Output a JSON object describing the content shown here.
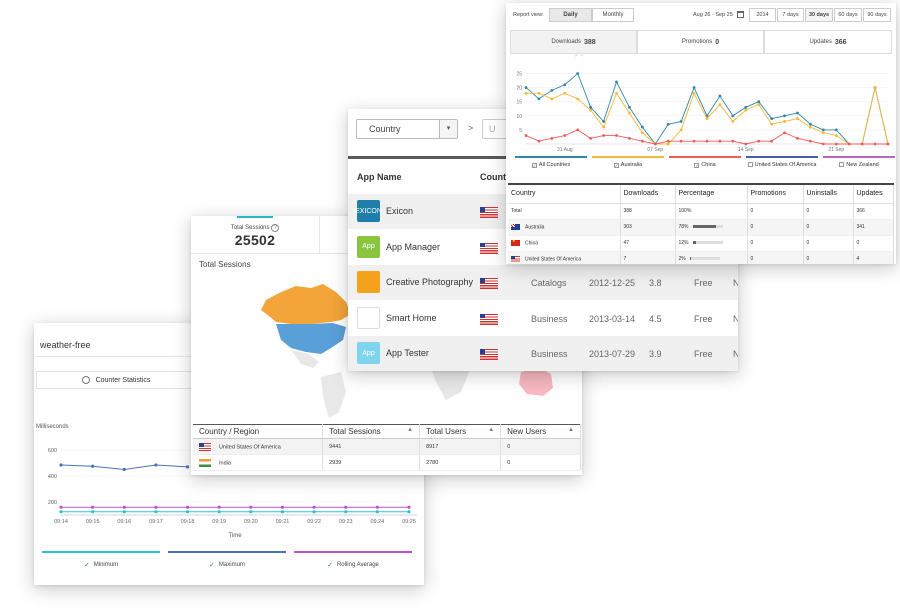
{
  "counter": {
    "app_name": "weather-free",
    "tab_label": "Counter Statistics",
    "y_axis_label": "Milliseconds",
    "x_axis_title": "Time",
    "legend": [
      {
        "name": "Minimum",
        "color": "#2ec4d6"
      },
      {
        "name": "Maximum",
        "color": "#4a72b8"
      },
      {
        "name": "Rolling Average",
        "color": "#c052c9"
      }
    ]
  },
  "sessions": {
    "stat_title": "Total Sessions",
    "stat_value": "25502",
    "map_title": "Total Sessions",
    "columns": [
      "Country / Region",
      "Total Sessions",
      "Total Users",
      "New Users"
    ],
    "rows": [
      {
        "country": "United States Of America",
        "flag": "us",
        "sessions": "9441",
        "users": "8917",
        "new_users": "0"
      },
      {
        "country": "India",
        "flag": "in",
        "sessions": "2939",
        "users": "2780",
        "new_users": "0"
      }
    ]
  },
  "apps": {
    "country_select": "Country",
    "country_select_caret": "▾",
    "breadcrumb_sep": ">",
    "next_select": "U",
    "header_app_name": "App Name",
    "header_country": "Count",
    "rows": [
      {
        "name": "Exicon",
        "icon_color": "#1f7fa8",
        "icon_text": "EXICON",
        "category": "",
        "date": "",
        "rating": "",
        "price": "",
        "extra": ""
      },
      {
        "name": "App Manager",
        "icon_color": "#8bc53f",
        "icon_text": "App",
        "category": "",
        "date": "",
        "rating": "",
        "price": "",
        "extra": ""
      },
      {
        "name": "Creative Photography",
        "icon_color": "#f4a21c",
        "icon_text": "",
        "category": "Catalogs",
        "date": "2012-12-25",
        "rating": "3.8",
        "price": "Free",
        "extra": "N"
      },
      {
        "name": "Smart Home",
        "icon_color": "#ffffff",
        "icon_text": "",
        "category": "Business",
        "date": "2013-03-14",
        "rating": "4.5",
        "price": "Free",
        "extra": "N"
      },
      {
        "name": "App Tester",
        "icon_color": "#7fd4ee",
        "icon_text": "App",
        "category": "Business",
        "date": "2013-07-29",
        "rating": "3.9",
        "price": "Free",
        "extra": "N"
      }
    ]
  },
  "report": {
    "view_label": "Report view:",
    "view_options": [
      "Daily",
      "Monthly"
    ],
    "date_range": "Aug 26 - Sep 25",
    "periods": [
      "2014",
      "7 days",
      "30 days",
      "60 days",
      "90 days"
    ],
    "kpis": [
      {
        "label": "Downloads",
        "value": "388"
      },
      {
        "label": "Promotions",
        "value": "0"
      },
      {
        "label": "Updates",
        "value": "366"
      }
    ],
    "series_legend": [
      {
        "name": "All Countries",
        "color": "#2f87a8",
        "checked": true
      },
      {
        "name": "Australia",
        "color": "#f4b73a",
        "checked": true
      },
      {
        "name": "China",
        "color": "#ef5a5a",
        "checked": true
      },
      {
        "name": "United States Of America",
        "color": "#3f5fa8",
        "checked": false
      },
      {
        "name": "New Zealand",
        "color": "#b866c4",
        "checked": false
      }
    ],
    "columns": [
      "Country",
      "Downloads",
      "Percentage",
      "Promotions",
      "Uninstalls",
      "Updates"
    ],
    "rows": [
      {
        "country": "Total",
        "flag": "",
        "downloads": "388",
        "percentage": "100%",
        "pct": 100,
        "promotions": "0",
        "uninstalls": "0",
        "updates": "366"
      },
      {
        "country": "Australia",
        "flag": "au",
        "downloads": "303",
        "percentage": "78%",
        "pct": 78,
        "promotions": "0",
        "uninstalls": "0",
        "updates": "341"
      },
      {
        "country": "China",
        "flag": "cn",
        "downloads": "47",
        "percentage": "12%",
        "pct": 12,
        "promotions": "0",
        "uninstalls": "0",
        "updates": "0"
      },
      {
        "country": "United States Of America",
        "flag": "us",
        "downloads": "7",
        "percentage": "2%",
        "pct": 2,
        "promotions": "0",
        "uninstalls": "0",
        "updates": "4"
      }
    ]
  },
  "chart_data": [
    {
      "type": "line",
      "ylabel": "Milliseconds",
      "xlabel": "Time",
      "x": [
        "09:14",
        "09:15",
        "09:16",
        "09:17",
        "09:18",
        "09:19",
        "09:20",
        "09:21",
        "09:22",
        "09:23",
        "09:24",
        "09:25"
      ],
      "y_ticks": [
        600,
        400,
        200
      ],
      "ylim": [
        100,
        700
      ],
      "series": [
        {
          "name": "Maximum",
          "color": "#4a72b8",
          "values": [
            485,
            475,
            450,
            485,
            470,
            null,
            null,
            null,
            null,
            null,
            null,
            null
          ]
        },
        {
          "name": "Rolling Average",
          "color": "#c052c9",
          "values": [
            160,
            160,
            160,
            160,
            160,
            160,
            160,
            160,
            160,
            160,
            160,
            160
          ]
        },
        {
          "name": "Minimum",
          "color": "#2ec4d6",
          "values": [
            125,
            125,
            125,
            125,
            125,
            125,
            125,
            125,
            125,
            125,
            125,
            125
          ]
        }
      ]
    },
    {
      "type": "line",
      "x_tick_labels": [
        {
          "i": 3,
          "label": "31 Aug"
        },
        {
          "i": 10,
          "label": "07 Sep"
        },
        {
          "i": 17,
          "label": "14 Sep"
        },
        {
          "i": 24,
          "label": "21 Sep"
        }
      ],
      "y_ticks": [
        25,
        20,
        15,
        10,
        5
      ],
      "ylim": [
        0,
        28
      ],
      "series": [
        {
          "name": "All Countries",
          "color": "#2f87a8",
          "values": [
            20,
            16,
            19,
            21,
            25,
            13,
            8,
            22,
            13,
            6,
            0,
            7,
            8,
            20,
            10,
            17,
            10,
            13,
            15,
            9,
            10,
            11,
            7,
            5,
            5,
            0,
            0,
            20,
            0
          ]
        },
        {
          "name": "Australia",
          "color": "#f4b73a",
          "values": [
            18,
            18,
            16,
            18,
            16,
            12,
            6,
            18,
            11,
            4,
            0,
            0,
            5,
            18,
            9,
            14,
            8,
            12,
            14,
            7,
            8,
            9,
            6,
            4,
            3,
            0,
            0,
            20,
            0
          ]
        },
        {
          "name": "China",
          "color": "#ef5a5a",
          "values": [
            3,
            1,
            2,
            3,
            5,
            2,
            3,
            3,
            2,
            1,
            0,
            1,
            1,
            1,
            1,
            1,
            1,
            0,
            1,
            1,
            4,
            2,
            1,
            0,
            0,
            0,
            0,
            0,
            0
          ]
        }
      ]
    }
  ]
}
